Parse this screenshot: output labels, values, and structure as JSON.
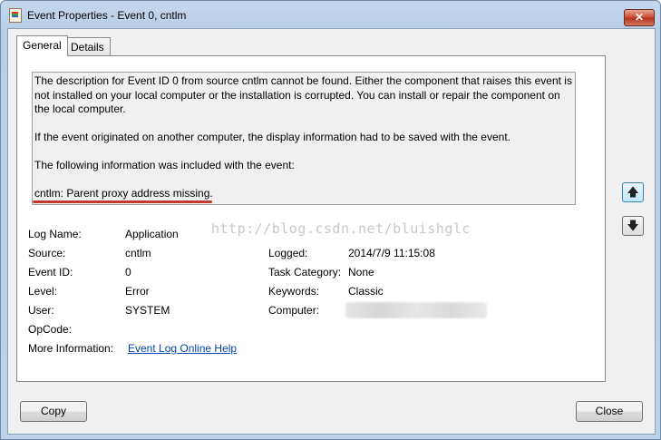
{
  "window": {
    "title": "Event Properties - Event 0, cntlm",
    "close_glyph": "✕"
  },
  "tabs": [
    {
      "label": "General"
    },
    {
      "label": "Details"
    }
  ],
  "description": {
    "para1": "The description for Event ID 0 from source cntlm cannot be found. Either the component that raises this event is not installed on your local computer or the installation is corrupted. You can install or repair the component on the local computer.",
    "para2": "If the event originated on another computer, the display information had to be saved with the event.",
    "para3": "The following information was included with the event:",
    "para4": "cntlm: Parent proxy address missing."
  },
  "watermark": "http://blog.csdn.net/bluishglc",
  "fields": {
    "log_name": {
      "label": "Log Name:",
      "value": "Application"
    },
    "source": {
      "label": "Source:",
      "value": "cntlm"
    },
    "logged": {
      "label": "Logged:",
      "value": "2014/7/9 11:15:08"
    },
    "event_id": {
      "label": "Event ID:",
      "value": "0"
    },
    "task_category": {
      "label": "Task Category:",
      "value": "None"
    },
    "level": {
      "label": "Level:",
      "value": "Error"
    },
    "keywords": {
      "label": "Keywords:",
      "value": "Classic"
    },
    "user": {
      "label": "User:",
      "value": "SYSTEM"
    },
    "computer": {
      "label": "Computer:",
      "value": ""
    },
    "opcode": {
      "label": "OpCode:",
      "value": ""
    },
    "more_info": {
      "label": "More Information:",
      "link": "Event Log Online Help"
    }
  },
  "nav": {
    "up_glyph": "🡅",
    "down_glyph": "🡇"
  },
  "buttons": {
    "copy": "Copy",
    "close": "Close"
  }
}
